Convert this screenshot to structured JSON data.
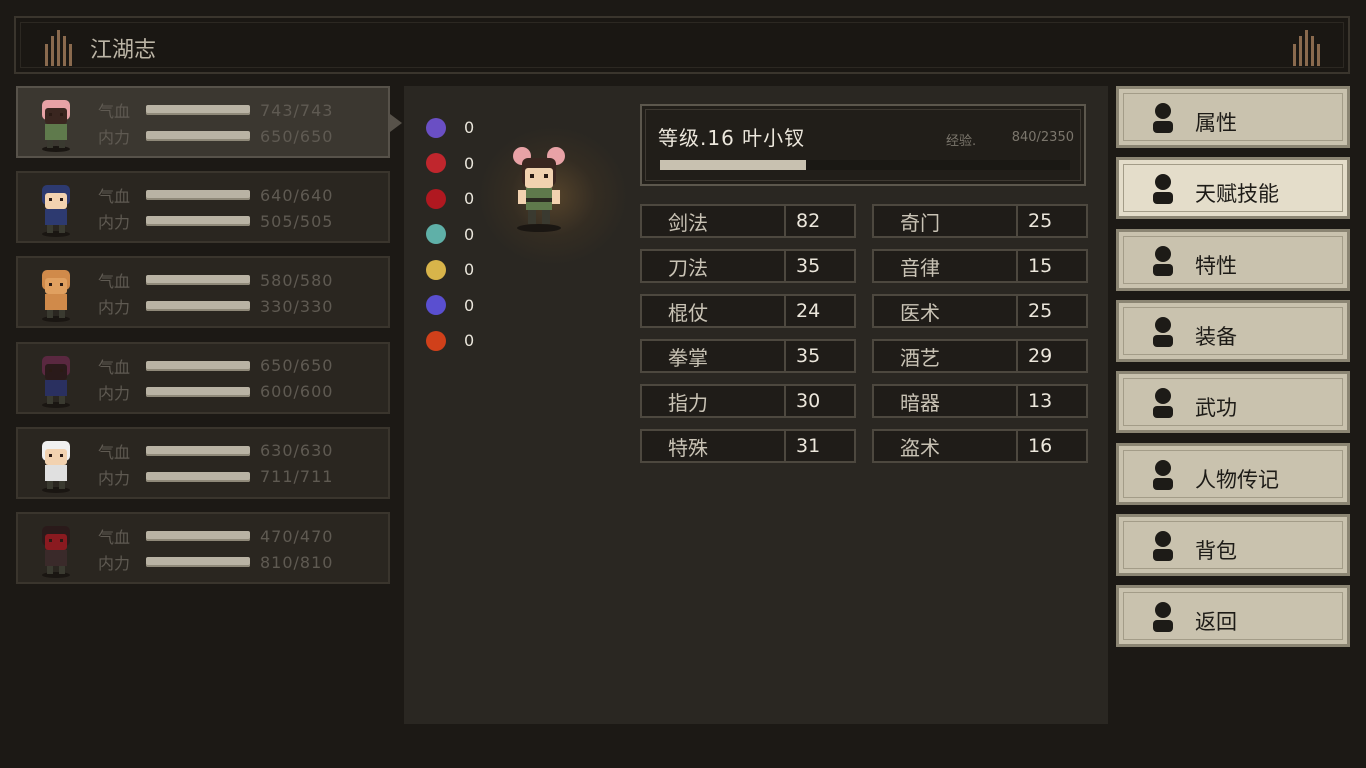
{
  "title": "江湖志",
  "party": [
    {
      "hp_label": "气血",
      "hp": "743/743",
      "mp_label": "内力",
      "mp": "650/650",
      "hp_fill": 1,
      "mp_fill": 1
    },
    {
      "hp_label": "气血",
      "hp": "640/640",
      "mp_label": "内力",
      "mp": "505/505",
      "hp_fill": 1,
      "mp_fill": 1
    },
    {
      "hp_label": "气血",
      "hp": "580/580",
      "mp_label": "内力",
      "mp": "330/330",
      "hp_fill": 1,
      "mp_fill": 1
    },
    {
      "hp_label": "气血",
      "hp": "650/650",
      "mp_label": "内力",
      "mp": "600/600",
      "hp_fill": 1,
      "mp_fill": 1
    },
    {
      "hp_label": "气血",
      "hp": "630/630",
      "mp_label": "内力",
      "mp": "711/711",
      "hp_fill": 1,
      "mp_fill": 1
    },
    {
      "hp_label": "气血",
      "hp": "470/470",
      "mp_label": "内力",
      "mp": "810/810",
      "hp_fill": 1,
      "mp_fill": 1
    }
  ],
  "status_effects": [
    {
      "icon": "skull-icon",
      "color": "#6a4fc4",
      "value": "0"
    },
    {
      "icon": "broken-heart-icon",
      "color": "#c0262d",
      "value": "0"
    },
    {
      "icon": "blood-drop-icon",
      "color": "#b01820",
      "value": "0"
    },
    {
      "icon": "poison-skull-icon",
      "color": "#5fb0a8",
      "value": "0"
    },
    {
      "icon": "stun-star-icon",
      "color": "#d8b44a",
      "value": "0"
    },
    {
      "icon": "curse-skull-icon",
      "color": "#5a4fd0",
      "value": "0"
    },
    {
      "icon": "fire-icon",
      "color": "#d0401a",
      "value": "0"
    }
  ],
  "character": {
    "level_text": "等级.16 叶小钗",
    "exp_label": "经验.",
    "exp": "840/2350",
    "exp_fill": 0.357
  },
  "attributes": [
    {
      "name": "剑法",
      "value": "82"
    },
    {
      "name": "奇门",
      "value": "25"
    },
    {
      "name": "刀法",
      "value": "35"
    },
    {
      "name": "音律",
      "value": "15"
    },
    {
      "name": "棍仗",
      "value": "24"
    },
    {
      "name": "医术",
      "value": "25"
    },
    {
      "name": "拳掌",
      "value": "35"
    },
    {
      "name": "酒艺",
      "value": "29"
    },
    {
      "name": "指力",
      "value": "30"
    },
    {
      "name": "暗器",
      "value": "13"
    },
    {
      "name": "特殊",
      "value": "31"
    },
    {
      "name": "盗术",
      "value": "16"
    }
  ],
  "menu": [
    {
      "label": "属性",
      "icon": "person-icon"
    },
    {
      "label": "天赋技能",
      "icon": "talent-icon"
    },
    {
      "label": "特性",
      "icon": "trait-heart-icon"
    },
    {
      "label": "装备",
      "icon": "sword-icon"
    },
    {
      "label": "武功",
      "icon": "martial-book-icon"
    },
    {
      "label": "人物传记",
      "icon": "biography-book-icon"
    },
    {
      "label": "背包",
      "icon": "bag-icon"
    },
    {
      "label": "返回",
      "icon": "door-icon"
    }
  ],
  "active_menu": "天赋技能",
  "colors": {
    "accent": "#c9c2ae",
    "panel": "#2a2722",
    "background": "#1c1915"
  }
}
